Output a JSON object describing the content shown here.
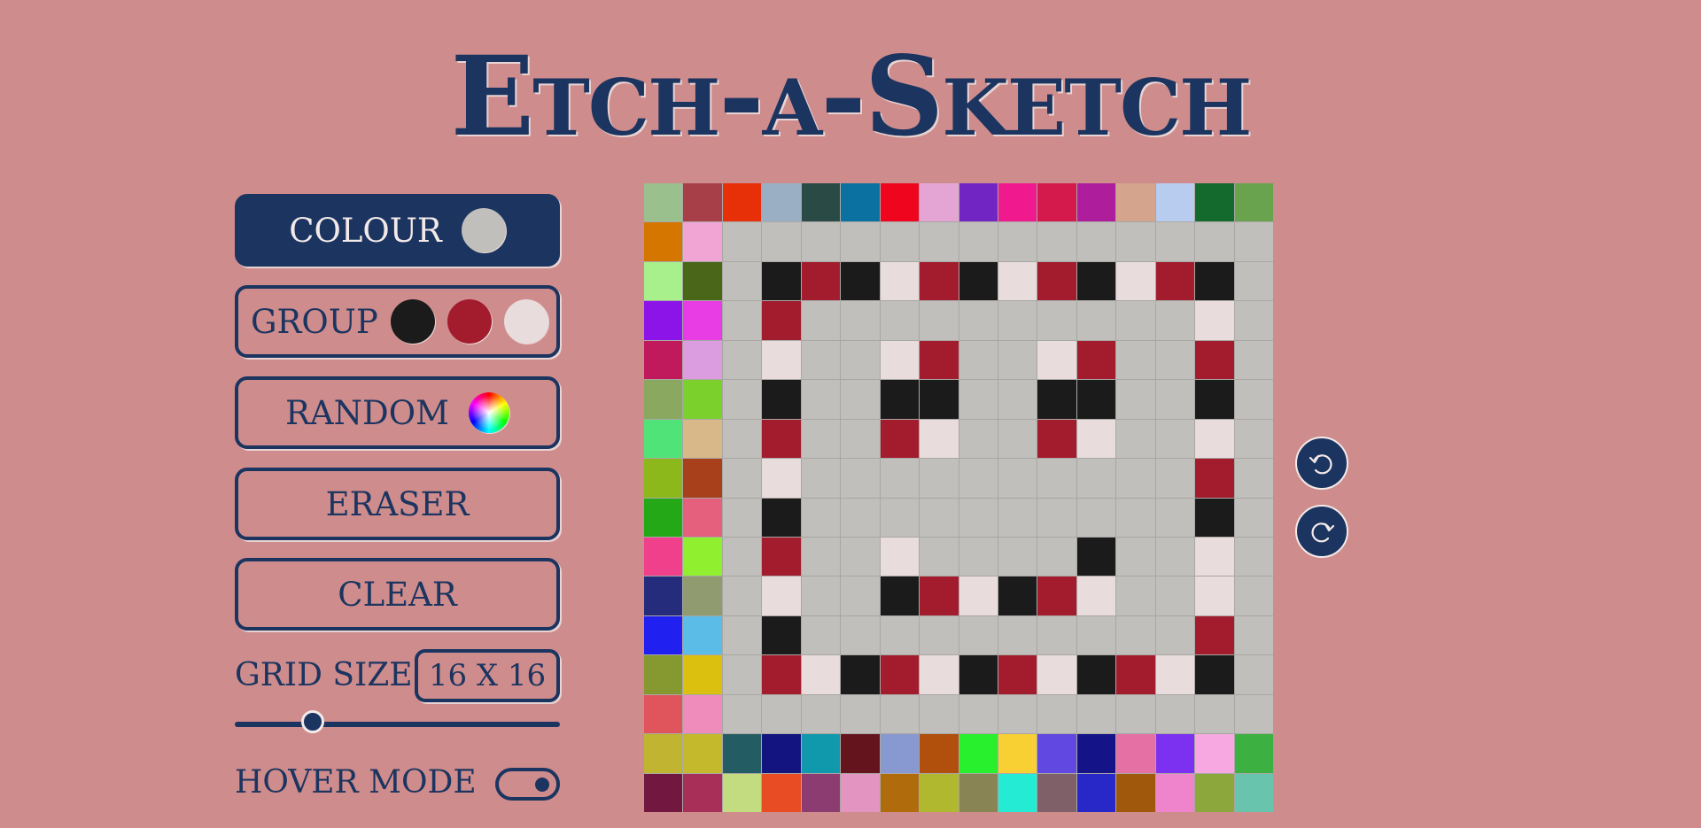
{
  "title": "Etch-a-Sketch",
  "controls": {
    "colour": {
      "label": "COLOUR",
      "swatch": "#c0bfbc"
    },
    "group": {
      "label": "GROUP",
      "swatches": [
        "#1b1b1b",
        "#a31c2e",
        "#e8dcdc"
      ]
    },
    "random": {
      "label": "RANDOM",
      "icon": "rainbow-wheel-icon"
    },
    "eraser": {
      "label": "ERASER"
    },
    "clear": {
      "label": "CLEAR"
    },
    "grid_size": {
      "label": "GRID SIZE",
      "value": "16 X 16",
      "slider_fraction": 0.24
    },
    "hover_mode": {
      "label": "HOVER MODE",
      "on": true
    }
  },
  "history": {
    "undo_icon": "undo-icon",
    "redo_icon": "redo-icon"
  },
  "colors": {
    "background": "#cf8c8c",
    "accent": "#1b3560",
    "empty_cell": "#c0bfbc"
  },
  "grid": {
    "size": 16,
    "rows": [
      [
        "#9ac08e",
        "#a63f48",
        "#e83008",
        "#9aafc4",
        "#2a4a45",
        "#0a71a0",
        "#f0051f",
        "#e4a5d5",
        "#7126c4",
        "#f01a8e",
        "#d41a4c",
        "#ad1d9c",
        "#d4a48c",
        "#b8ccf0",
        "#146a2c",
        "#6aa34e"
      ],
      [
        "#d47600",
        "#f0a5d5",
        "#c0bfbc",
        "#c0bfbc",
        "#c0bfbc",
        "#c0bfbc",
        "#c0bfbc",
        "#c0bfbc",
        "#c0bfbc",
        "#c0bfbc",
        "#c0bfbc",
        "#c0bfbc",
        "#c0bfbc",
        "#c0bfbc",
        "#c0bfbc",
        "#c0bfbc"
      ],
      [
        "#a8f08c",
        "#4a6618",
        "#c0bfbc",
        "#1b1b1b",
        "#a31c2e",
        "#1b1b1b",
        "#e8dcdc",
        "#a31c2e",
        "#1b1b1b",
        "#e8dcdc",
        "#a31c2e",
        "#1b1b1b",
        "#e8dcdc",
        "#a31c2e",
        "#1b1b1b",
        "#c0bfbc"
      ],
      [
        "#8c14e8",
        "#e83ce4",
        "#c0bfbc",
        "#a31c2e",
        "#c0bfbc",
        "#c0bfbc",
        "#c0bfbc",
        "#c0bfbc",
        "#c0bfbc",
        "#c0bfbc",
        "#c0bfbc",
        "#c0bfbc",
        "#c0bfbc",
        "#c0bfbc",
        "#e8dcdc",
        "#c0bfbc"
      ],
      [
        "#c01a5c",
        "#dc9ce0",
        "#c0bfbc",
        "#e8dcdc",
        "#c0bfbc",
        "#c0bfbc",
        "#e8dcdc",
        "#a31c2e",
        "#c0bfbc",
        "#c0bfbc",
        "#e8dcdc",
        "#a31c2e",
        "#c0bfbc",
        "#c0bfbc",
        "#a31c2e",
        "#c0bfbc"
      ],
      [
        "#8aa860",
        "#7cd02c",
        "#c0bfbc",
        "#1b1b1b",
        "#c0bfbc",
        "#c0bfbc",
        "#1b1b1b",
        "#1b1b1b",
        "#c0bfbc",
        "#c0bfbc",
        "#1b1b1b",
        "#1b1b1b",
        "#c0bfbc",
        "#c0bfbc",
        "#1b1b1b",
        "#c0bfbc"
      ],
      [
        "#50e478",
        "#d8b888",
        "#c0bfbc",
        "#a31c2e",
        "#c0bfbc",
        "#c0bfbc",
        "#a31c2e",
        "#e8dcdc",
        "#c0bfbc",
        "#c0bfbc",
        "#a31c2e",
        "#e8dcdc",
        "#c0bfbc",
        "#c0bfbc",
        "#e8dcdc",
        "#c0bfbc"
      ],
      [
        "#8cb81c",
        "#a8401c",
        "#c0bfbc",
        "#e8dcdc",
        "#c0bfbc",
        "#c0bfbc",
        "#c0bfbc",
        "#c0bfbc",
        "#c0bfbc",
        "#c0bfbc",
        "#c0bfbc",
        "#c0bfbc",
        "#c0bfbc",
        "#c0bfbc",
        "#a31c2e",
        "#c0bfbc"
      ],
      [
        "#24a818",
        "#e4607c",
        "#c0bfbc",
        "#1b1b1b",
        "#c0bfbc",
        "#c0bfbc",
        "#c0bfbc",
        "#c0bfbc",
        "#c0bfbc",
        "#c0bfbc",
        "#c0bfbc",
        "#c0bfbc",
        "#c0bfbc",
        "#c0bfbc",
        "#1b1b1b",
        "#c0bfbc"
      ],
      [
        "#f0408c",
        "#90f030",
        "#c0bfbc",
        "#a31c2e",
        "#c0bfbc",
        "#c0bfbc",
        "#e8dcdc",
        "#c0bfbc",
        "#c0bfbc",
        "#c0bfbc",
        "#c0bfbc",
        "#1b1b1b",
        "#c0bfbc",
        "#c0bfbc",
        "#e8dcdc",
        "#c0bfbc"
      ],
      [
        "#262c7c",
        "#909c70",
        "#c0bfbc",
        "#e8dcdc",
        "#c0bfbc",
        "#c0bfbc",
        "#1b1b1b",
        "#a31c2e",
        "#e8dcdc",
        "#1b1b1b",
        "#a31c2e",
        "#e8dcdc",
        "#c0bfbc",
        "#c0bfbc",
        "#e8dcdc",
        "#c0bfbc"
      ],
      [
        "#2020f0",
        "#5cbce8",
        "#c0bfbc",
        "#1b1b1b",
        "#c0bfbc",
        "#c0bfbc",
        "#c0bfbc",
        "#c0bfbc",
        "#c0bfbc",
        "#c0bfbc",
        "#c0bfbc",
        "#c0bfbc",
        "#c0bfbc",
        "#c0bfbc",
        "#a31c2e",
        "#c0bfbc"
      ],
      [
        "#869830",
        "#dcc010",
        "#c0bfbc",
        "#a31c2e",
        "#e8dcdc",
        "#1b1b1b",
        "#a31c2e",
        "#e8dcdc",
        "#1b1b1b",
        "#a31c2e",
        "#e8dcdc",
        "#1b1b1b",
        "#a31c2e",
        "#e8dcdc",
        "#1b1b1b",
        "#c0bfbc"
      ],
      [
        "#e0545c",
        "#f08cbc",
        "#c0bfbc",
        "#c0bfbc",
        "#c0bfbc",
        "#c0bfbc",
        "#c0bfbc",
        "#c0bfbc",
        "#c0bfbc",
        "#c0bfbc",
        "#c0bfbc",
        "#c0bfbc",
        "#c0bfbc",
        "#c0bfbc",
        "#c0bfbc",
        "#c0bfbc"
      ],
      [
        "#c0b430",
        "#c4b82c",
        "#245c64",
        "#141480",
        "#1098ac",
        "#64141c",
        "#8898d0",
        "#b0500c",
        "#28f02c",
        "#f8d034",
        "#6048e0",
        "#141488",
        "#e470a4",
        "#7c30f0",
        "#f8a8e0",
        "#3cb040"
      ],
      [
        "#721840",
        "#a83058",
        "#c4dc80",
        "#e84c24",
        "#8c3c70",
        "#e494c0",
        "#b06c0c",
        "#b0b830",
        "#888454",
        "#24ecd4",
        "#806068",
        "#2828c8",
        "#a0580c",
        "#f084cc",
        "#8ca83c",
        "#68c4ac"
      ]
    ]
  }
}
